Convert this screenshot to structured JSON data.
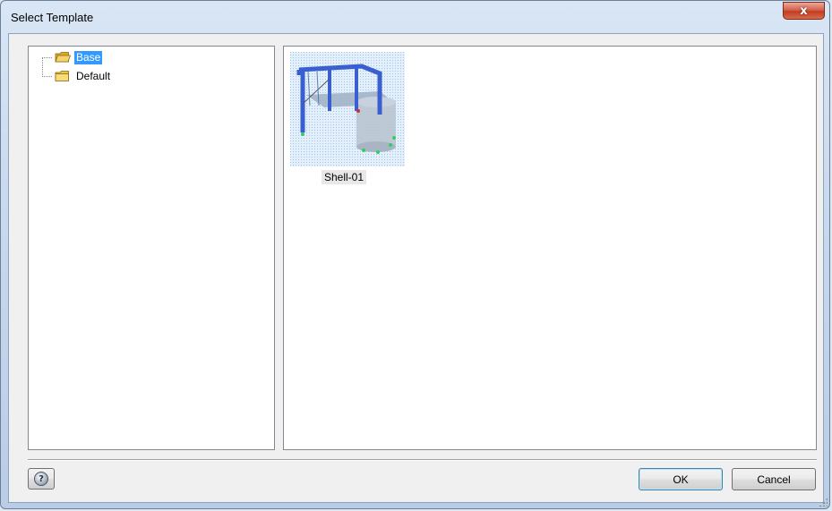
{
  "window": {
    "title": "Select Template",
    "close_glyph": "x"
  },
  "tree": {
    "items": [
      {
        "label": "Base",
        "icon": "folder-icon",
        "selected": true
      },
      {
        "label": "Default",
        "icon": "folder-icon",
        "selected": false
      }
    ]
  },
  "templates": [
    {
      "name": "Shell-01",
      "icon": "structure-thumbnail"
    }
  ],
  "buttons": {
    "help_icon": "help-icon",
    "help_glyph": "?",
    "ok_label": "OK",
    "cancel_label": "Cancel"
  },
  "colors": {
    "selection": "#3399ff",
    "close_button": "#c23d22",
    "folder": "#e8c44a",
    "frame_blue": "#3a5fd0"
  }
}
